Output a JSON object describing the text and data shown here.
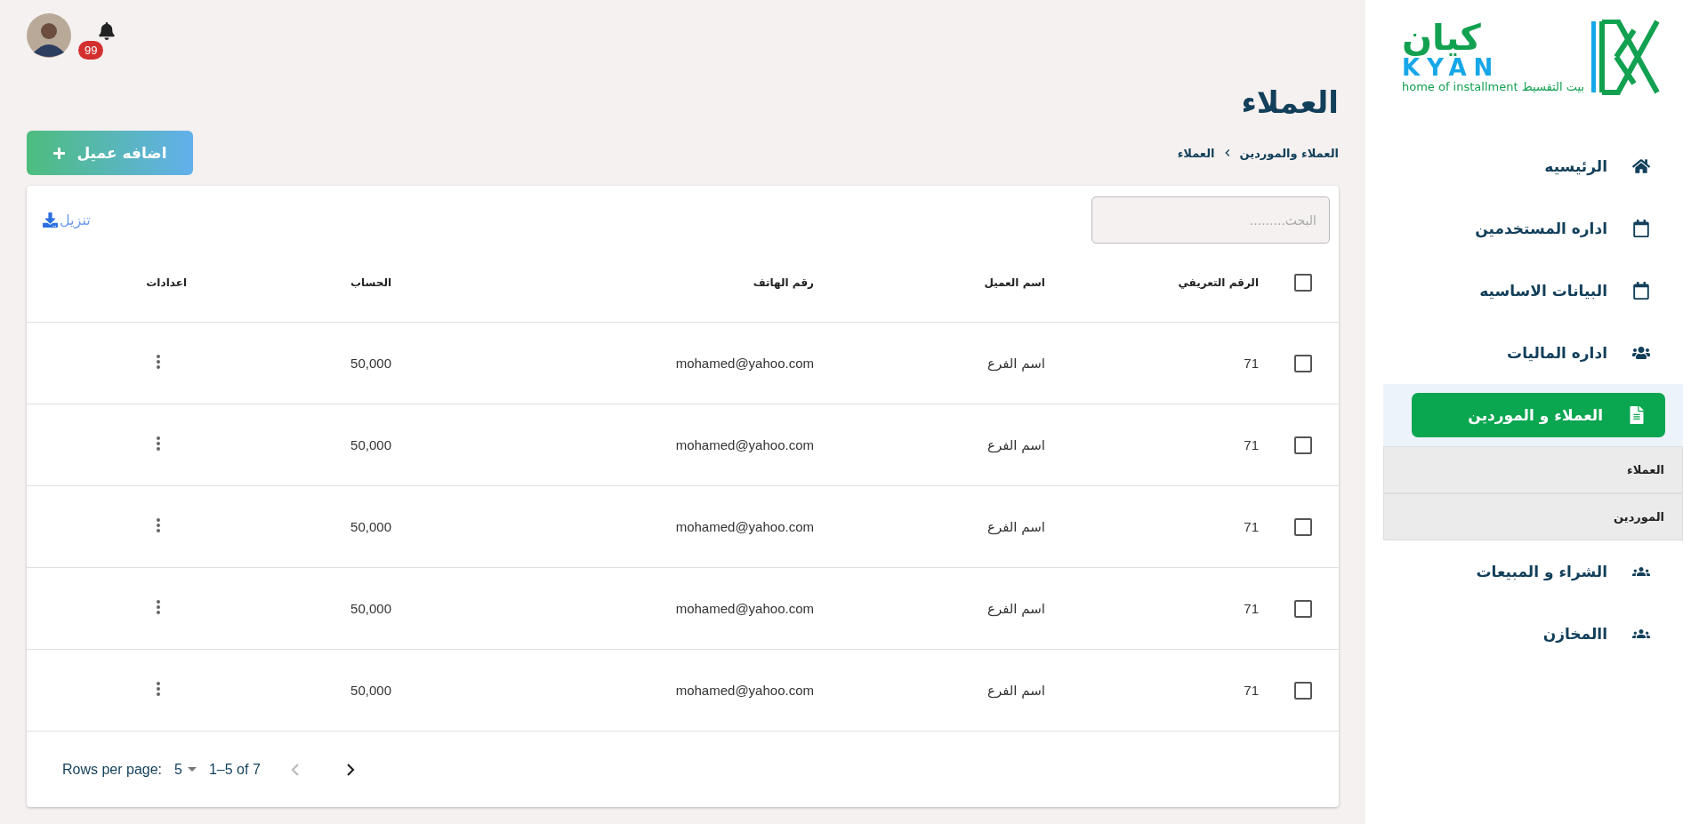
{
  "header": {
    "notification_count": "99"
  },
  "logo": {
    "arabic": "كيان",
    "latin": "KYAN",
    "tagline": "home of installment بيت التقسيط"
  },
  "page_title": "العملاء",
  "breadcrumb": [
    "العملاء والموردين",
    "العملاء"
  ],
  "add_button": {
    "label": "اضافه عميل"
  },
  "search": {
    "placeholder": "البحث........."
  },
  "download": {
    "label": "تنزيل"
  },
  "sidebar": {
    "items": [
      {
        "label": "الرئيسيه",
        "kind": "home",
        "selected": false
      },
      {
        "label": "اداره المستخدمين",
        "kind": "calendar",
        "selected": false
      },
      {
        "label": "البيانات الاساسيه",
        "kind": "calendar",
        "selected": false
      },
      {
        "label": "اداره الماليات",
        "kind": "users",
        "selected": false
      },
      {
        "label": "العملاء و الموردين",
        "kind": "file",
        "selected": true,
        "expanded": true,
        "children": [
          {
            "label": "العملاء"
          },
          {
            "label": "الموردين"
          }
        ]
      },
      {
        "label": "الشراء و المبيعات",
        "kind": "group",
        "selected": false
      },
      {
        "label": "االمخازن",
        "kind": "group",
        "selected": false
      }
    ]
  },
  "table": {
    "select_all_checked": false,
    "columns": [
      "الرقم التعريفي",
      "اسم العميل",
      "رقم الهاتف",
      "الحساب",
      "اعدادات"
    ],
    "rows": [
      {
        "checked": false,
        "cells": [
          "71",
          "اسم الفرع",
          "mohamed@yahoo.com",
          "50,000"
        ]
      },
      {
        "checked": false,
        "cells": [
          "71",
          "اسم الفرع",
          "mohamed@yahoo.com",
          "50,000"
        ]
      },
      {
        "checked": false,
        "cells": [
          "71",
          "اسم الفرع",
          "mohamed@yahoo.com",
          "50,000"
        ]
      },
      {
        "checked": false,
        "cells": [
          "71",
          "اسم الفرع",
          "mohamed@yahoo.com",
          "50,000"
        ]
      },
      {
        "checked": false,
        "cells": [
          "71",
          "اسم الفرع",
          "mohamed@yahoo.com",
          "50,000"
        ]
      }
    ]
  },
  "pagination": {
    "rows_per_page_label": "Rows per page:",
    "rows_per_page": "5",
    "range": "1–5 of 7",
    "prev_disabled": true,
    "next_disabled": false
  }
}
